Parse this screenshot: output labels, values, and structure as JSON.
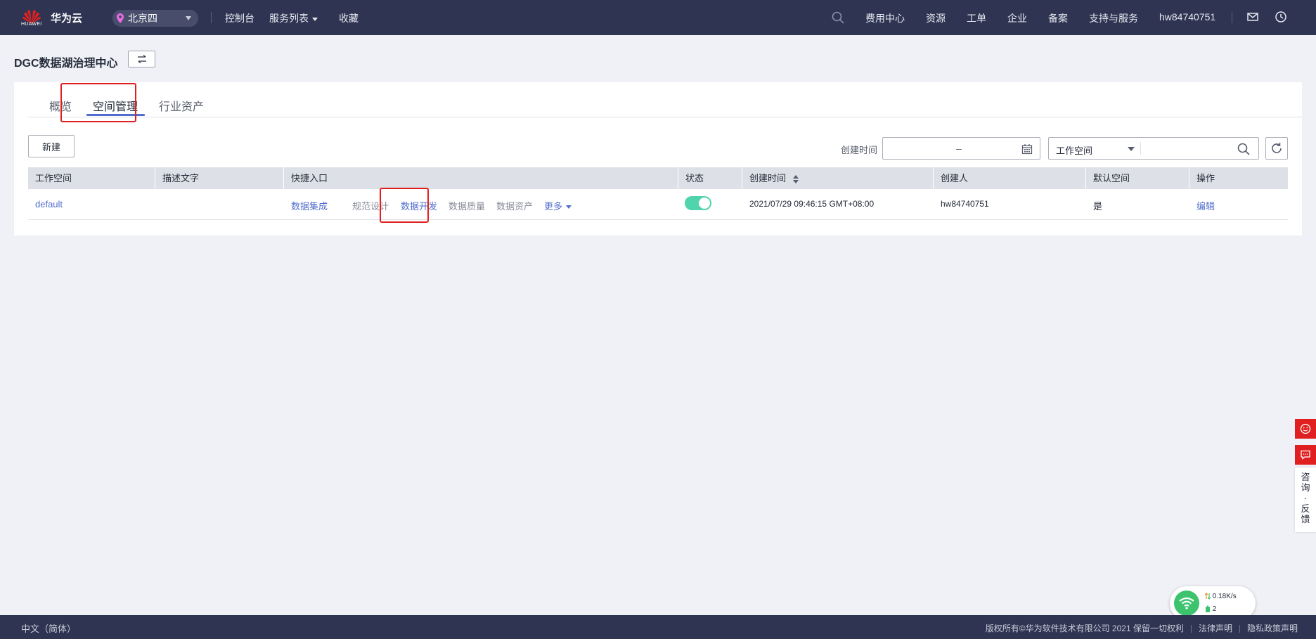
{
  "nav": {
    "logo_text": "HUAWEI",
    "brand": "华为云",
    "region": "北京四",
    "console": "控制台",
    "services": "服务列表",
    "favorites": "收藏",
    "right_links": [
      "费用中心",
      "资源",
      "工单",
      "企业",
      "备案",
      "支持与服务"
    ],
    "username": "hw84740751"
  },
  "page": {
    "title": "DGC数据湖治理中心"
  },
  "tabs": [
    {
      "label": "概览",
      "active": false
    },
    {
      "label": "空间管理",
      "active": true
    },
    {
      "label": "行业资产",
      "active": false
    }
  ],
  "toolbar": {
    "new_label": "新建",
    "created_time_label": "创建时间",
    "date_separator": "–",
    "workspace_filter": "工作空间"
  },
  "table": {
    "headers": [
      "工作空间",
      "描述文字",
      "快捷入口",
      "状态",
      "创建时间",
      "创建人",
      "默认空间",
      "操作"
    ],
    "rows": [
      {
        "workspace": "default",
        "description": "",
        "shortcuts": [
          "数据集成",
          "规范设计",
          "数据开发",
          "数据质量",
          "数据资产"
        ],
        "more": "更多",
        "status_on": true,
        "created_time": "2021/07/29 09:46:15 GMT+08:00",
        "creator": "hw84740751",
        "default_space": "是",
        "action": "编辑"
      }
    ]
  },
  "float": {
    "feedback_chars": [
      "咨",
      "询",
      "·",
      "反",
      "馈"
    ]
  },
  "network": {
    "speed": "0.18K/s",
    "count": "2"
  },
  "footer": {
    "lang": "中文（简体）",
    "copyright": "版权所有©华为软件技术有限公司 2021 保留一切权利",
    "legal": "法律声明",
    "privacy": "隐私政策声明"
  },
  "colors": {
    "nav_bg": "#2e3452",
    "page_bg": "#eff1f6",
    "link": "#526ecc",
    "toggle_on": "#50d4ab",
    "highlight": "#e02020"
  }
}
